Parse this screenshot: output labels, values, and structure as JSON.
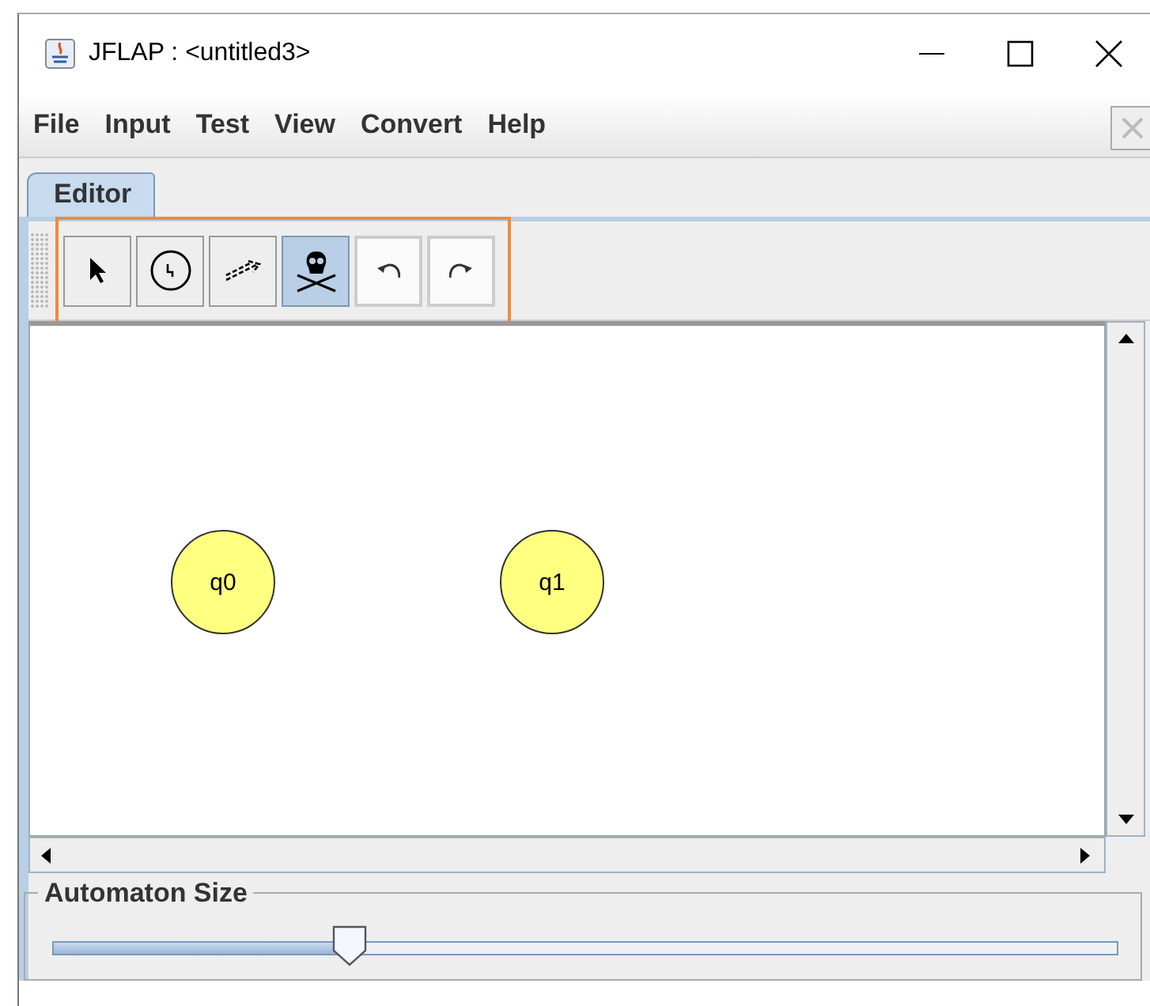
{
  "window": {
    "title": "JFLAP : <untitled3>"
  },
  "menu": [
    "File",
    "Input",
    "Test",
    "View",
    "Convert",
    "Help"
  ],
  "tabs": [
    {
      "label": "Editor",
      "selected": true
    }
  ],
  "toolbar": [
    {
      "kind": "pointer",
      "selected": false
    },
    {
      "kind": "state",
      "selected": false
    },
    {
      "kind": "transition",
      "selected": false
    },
    {
      "kind": "delete",
      "selected": true
    },
    {
      "kind": "undo",
      "selected": false
    },
    {
      "kind": "redo",
      "selected": false
    }
  ],
  "states": [
    {
      "label": "q0"
    },
    {
      "label": "q1"
    }
  ],
  "slider": {
    "title": "Automaton Size",
    "level": 0.28
  }
}
